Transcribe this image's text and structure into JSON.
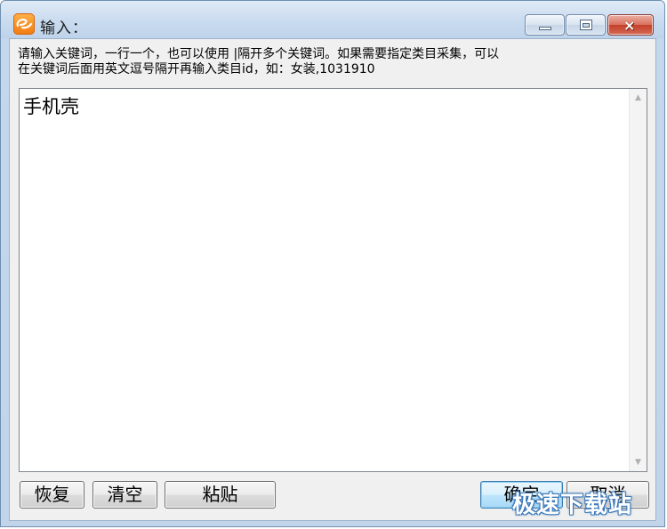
{
  "window": {
    "title": "输入：",
    "app_icon": "alibaba-logo-icon",
    "controls": {
      "minimize_icon": "minimize-icon",
      "maximize_icon": "maximize-icon",
      "close_label": "×"
    }
  },
  "instruction": {
    "text": "请输入关键词，一行一个，也可以使用 |隔开多个关键词。如果需要指定类目采集，可以\n在关键词后面用英文逗号隔开再输入类目id，如：女装,1031910"
  },
  "keywords_input": {
    "value": "手机壳"
  },
  "buttons": {
    "restore": "恢复",
    "clear": "清空",
    "paste": "粘贴",
    "ok": "确定",
    "cancel": "取消"
  },
  "watermark": {
    "text": "极速下载站"
  },
  "colors": {
    "title_bar": "#c9dbef",
    "close_button": "#c4402a",
    "default_button": "#a7d9f5",
    "dialog_background": "#f0f0f0"
  }
}
